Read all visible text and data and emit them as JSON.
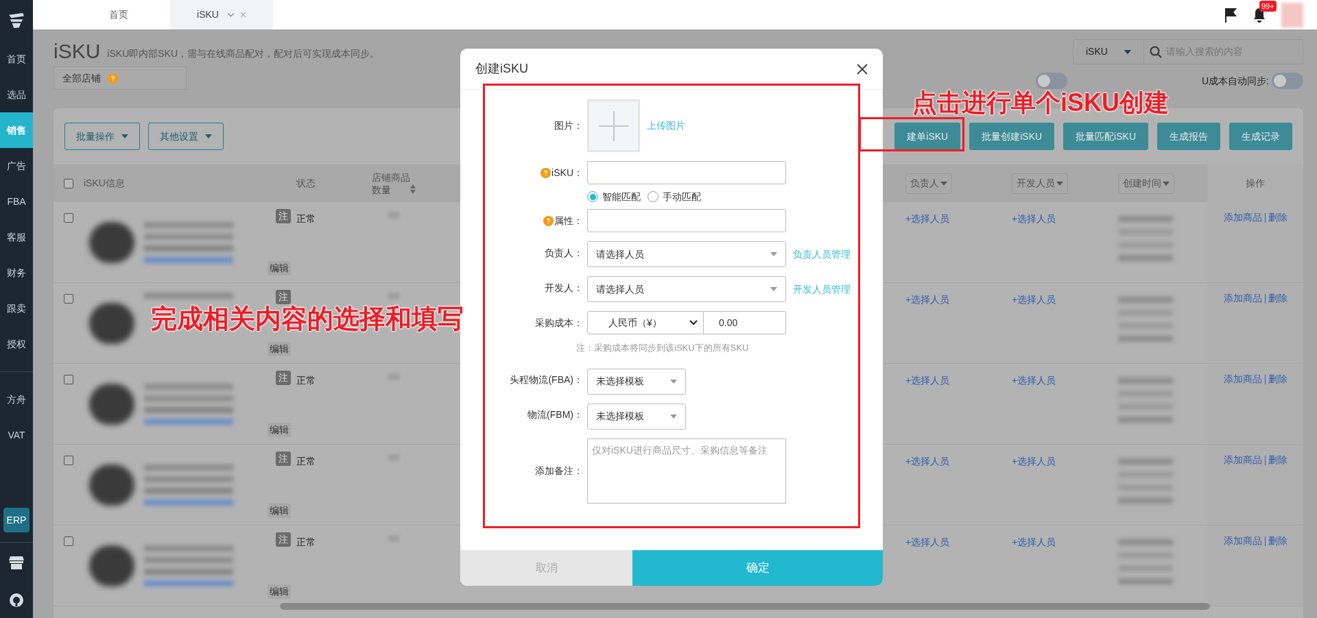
{
  "sidebar": {
    "items": [
      {
        "label": "首页",
        "selected": false
      },
      {
        "label": "选品",
        "selected": false
      },
      {
        "label": "销售",
        "selected": true
      },
      {
        "label": "广告",
        "selected": false
      },
      {
        "label": "FBA",
        "selected": false
      },
      {
        "label": "客服",
        "selected": false
      },
      {
        "label": "财务",
        "selected": false
      },
      {
        "label": "跟卖",
        "selected": false
      },
      {
        "label": "授权",
        "selected": false
      }
    ],
    "items_2": [
      {
        "label": "方舟",
        "selected": false
      },
      {
        "label": "VAT",
        "selected": false
      }
    ],
    "erp": "ERP"
  },
  "tabs": [
    {
      "label": "首页",
      "selected": false,
      "closable": false
    },
    {
      "label": "iSKU",
      "selected": true,
      "closable": true
    }
  ],
  "notifications": {
    "badge": "99+"
  },
  "page": {
    "title": "iSKU",
    "description": "iSKU即内部SKU，需与在线商品配对，配对后可实现成本同步。",
    "store_filter": "全部店铺",
    "search": {
      "scope": "iSKU",
      "placeholder": "请输入搜索的内容"
    },
    "toggles": [
      {
        "on": false
      },
      {
        "label": "U成本自动同步:",
        "on": false
      }
    ]
  },
  "toolbar": {
    "menus": [
      "批量操作",
      "其他设置"
    ],
    "buttons": [
      "建单iSKU",
      "批量创建iSKU",
      "批量匹配iSKU",
      "生成报告",
      "生成记录"
    ]
  },
  "table": {
    "select_all_checked": false,
    "columns": [
      {
        "label": "iSKU信息",
        "kind": "plain"
      },
      {
        "label": "状态",
        "kind": "plain"
      },
      {
        "label": "店铺商品数量",
        "kind": "sort"
      },
      {
        "label": "负责人",
        "kind": "filter"
      },
      {
        "label": "开发人员",
        "kind": "filter"
      },
      {
        "label": "创建时间",
        "kind": "filter"
      },
      {
        "label": "操作",
        "kind": "fixed"
      }
    ],
    "rows": [
      {
        "checked": false,
        "tag": "注",
        "edit": "编辑",
        "status": "正常",
        "owner": "+选择人员",
        "developer": "+选择人员",
        "actions": [
          "添加商品",
          "删除"
        ]
      },
      {
        "checked": false,
        "tag": "注",
        "edit": "编辑",
        "owner": "+选择人员",
        "developer": "+选择人员",
        "actions": [
          "添加商品",
          "删除"
        ]
      },
      {
        "checked": false,
        "tag": "注",
        "edit": "编辑",
        "status": "正常",
        "owner": "+选择人员",
        "developer": "+选择人员",
        "actions": [
          "添加商品",
          "删除"
        ]
      },
      {
        "checked": false,
        "tag": "注",
        "edit": "编辑",
        "status": "正常",
        "owner": "+选择人员",
        "developer": "+选择人员",
        "actions": [
          "添加商品",
          "删除"
        ]
      },
      {
        "checked": false,
        "tag": "注",
        "edit": "编辑",
        "status": "正常",
        "owner": "+选择人员",
        "developer": "+选择人员",
        "actions": [
          "添加商品",
          "删除"
        ]
      }
    ]
  },
  "modal": {
    "title": "创建iSKU",
    "fields": [
      {
        "kind": "image",
        "label": "图片：",
        "link": "上传图片"
      },
      {
        "kind": "text",
        "label": "iSKU：",
        "help": true
      },
      {
        "kind": "radio",
        "options": [
          {
            "label": "智能匹配",
            "selected": true
          },
          {
            "label": "手动匹配",
            "selected": false
          }
        ]
      },
      {
        "kind": "text",
        "label": "属性：",
        "help": true
      },
      {
        "kind": "select",
        "label": "负责人：",
        "value": "请选择人员",
        "link": "负责人员管理"
      },
      {
        "kind": "select",
        "label": "开发人：",
        "value": "请选择人员",
        "link": "开发人员管理"
      },
      {
        "kind": "currency",
        "label": "采购成本：",
        "currency": "人民币（¥）",
        "value": "0.00",
        "note": "注：采购成本将同步到该iSKU下的所有SKU"
      },
      {
        "kind": "small_select",
        "label": "头程物流(FBA)：",
        "value": "未选择模板"
      },
      {
        "kind": "small_select",
        "label": "物流(FBM)：",
        "value": "未选择模板"
      },
      {
        "kind": "textarea",
        "label": "添加备注：",
        "placeholder": "仅对iSKU进行商品尺寸、采购信息等备注"
      }
    ],
    "cancel": "取消",
    "confirm": "确定"
  },
  "annotations": [
    {
      "text": "点击进行单个iSKU创建"
    },
    {
      "text": "完成相关内容的选择和填写"
    }
  ]
}
